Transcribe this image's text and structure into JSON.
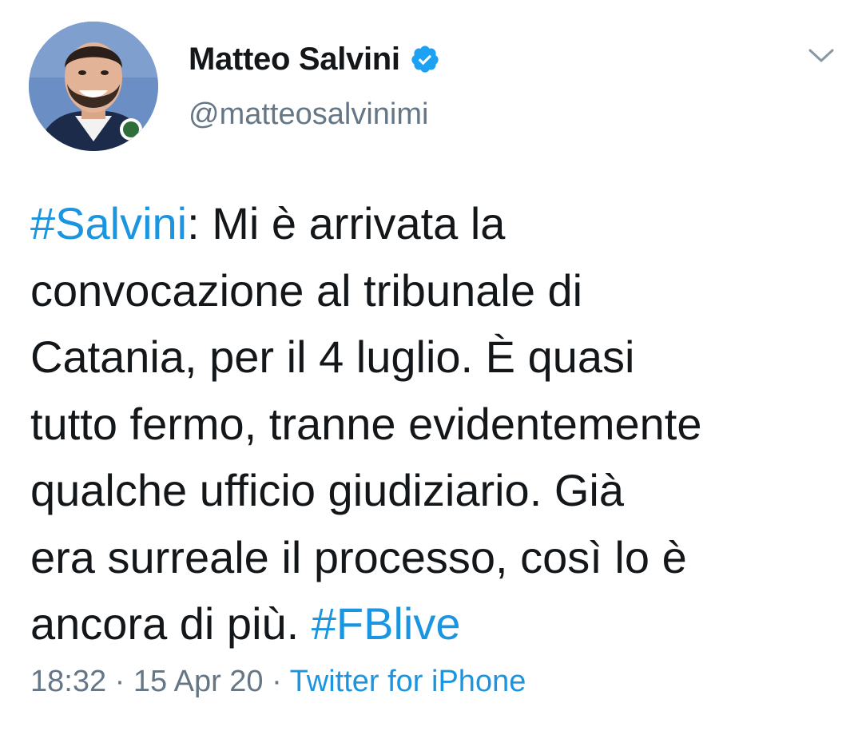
{
  "author": {
    "display_name": "Matteo Salvini",
    "handle": "@matteosalvinimi",
    "verified": true,
    "verified_icon": "verified-badge-icon"
  },
  "menu": {
    "icon": "chevron-down-icon"
  },
  "tweet": {
    "line1_hashtag": "#Salvini",
    "line1_rest": ": Mi è arrivata la",
    "line2": "convocazione al tribunale di",
    "line3": "Catania, per il 4 luglio. È quasi",
    "line4": "tutto fermo, tranne evidentemente",
    "line5": "qualche ufficio giudiziario. Già",
    "line6": "era surreale il processo, così lo è",
    "line7_text": "ancora di più. ",
    "line7_hashtag": "#FBlive"
  },
  "meta": {
    "time": "18:32",
    "separator1": " · ",
    "date": "15 Apr 20",
    "separator2": " · ",
    "source": "Twitter for iPhone"
  },
  "colors": {
    "link": "#1b95e0",
    "verified": "#1da1f2",
    "secondary_text": "#657786",
    "primary_text": "#14171a"
  }
}
